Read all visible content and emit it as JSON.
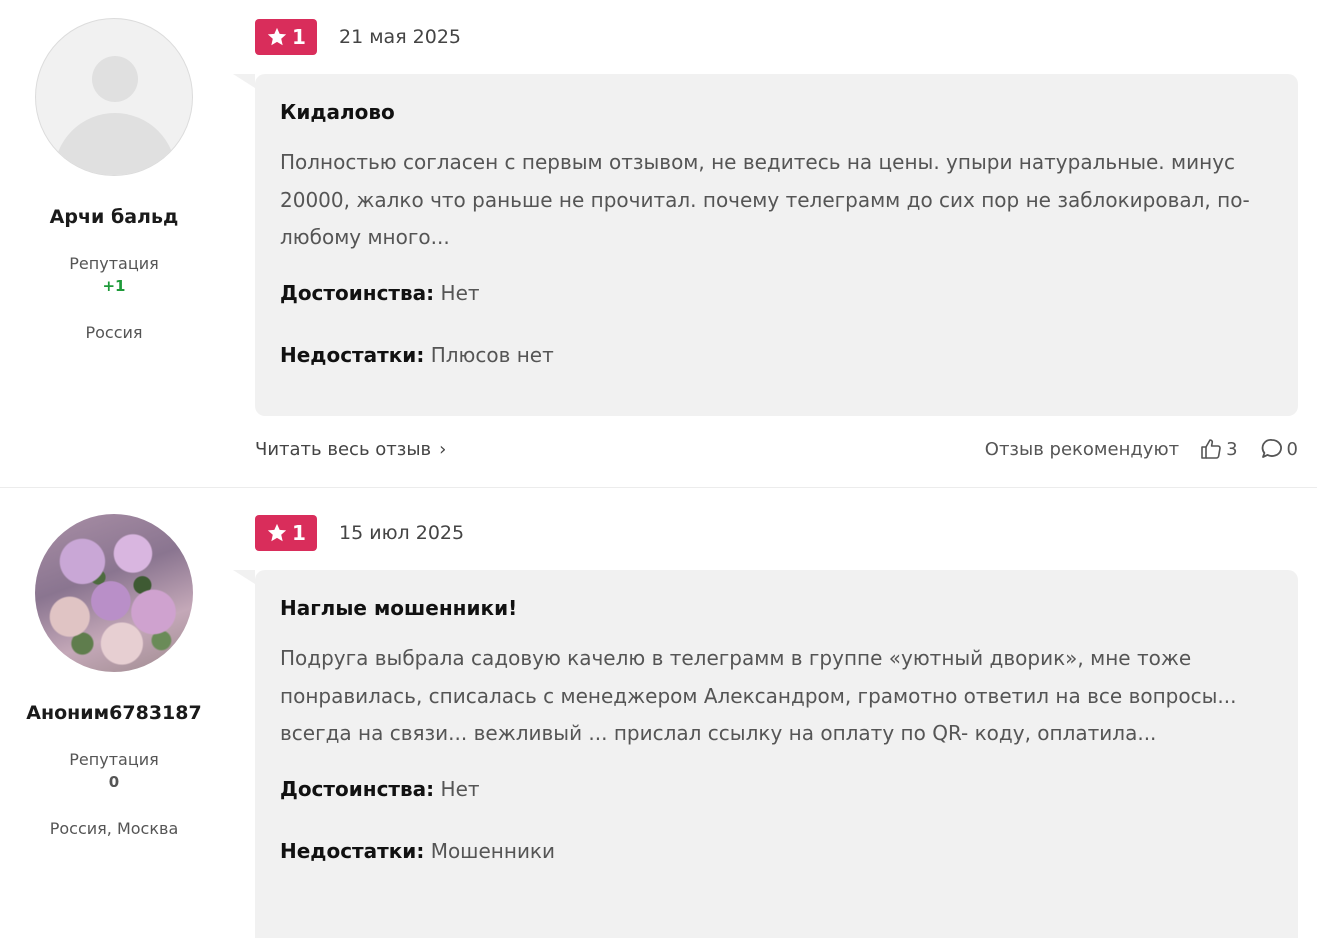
{
  "reviews": [
    {
      "author": {
        "name": "Арчи бальд",
        "reputation_label": "Репутация",
        "reputation": "+1",
        "location": "Россия",
        "avatar": "default-avatar-icon"
      },
      "rating": "1",
      "date": "21 мая 2025",
      "title": "Кидалово",
      "text": "Полностью согласен с первым отзывом, не ведитесь на цены. упыри натуральные. минус 20000, жалко что раньше не прочитал. почему телеграмм до сих пор не заблокировал, по-любому много...",
      "pros_label": "Достоинства:",
      "pros": "Нет",
      "cons_label": "Недостатки:",
      "cons": "Плюсов нет",
      "read_more": "Читать весь отзыв",
      "recommend_label": "Отзыв рекомендуют",
      "likes": "3",
      "comments": "0"
    },
    {
      "author": {
        "name": "Аноним6783187",
        "reputation_label": "Репутация",
        "reputation": "0",
        "location": "Россия, Москва",
        "avatar": "flowers-photo"
      },
      "rating": "1",
      "date": "15 июл 2025",
      "title": "Наглые мошенники!",
      "text": "Подруга выбрала садовую качелю в телеграмм в группе «уютный дворик», мне тоже понравилась, списалась с менеджером Александром, грамотно ответил на все вопросы... всегда на связи... вежливый ... прислал ссылку на оплату по QR- коду, оплатила...",
      "pros_label": "Достоинства:",
      "pros": "Нет",
      "cons_label": "Недостатки:",
      "cons": "Мошенники"
    }
  ],
  "colors": {
    "rating_badge": "#d92d5b",
    "bubble_bg": "#f1f1f1",
    "reputation_positive": "#1e9a3a"
  },
  "icons": {
    "star": "star-icon",
    "like": "thumbs-up-icon",
    "comment": "comment-icon",
    "chevron": "chevron-right-icon"
  }
}
